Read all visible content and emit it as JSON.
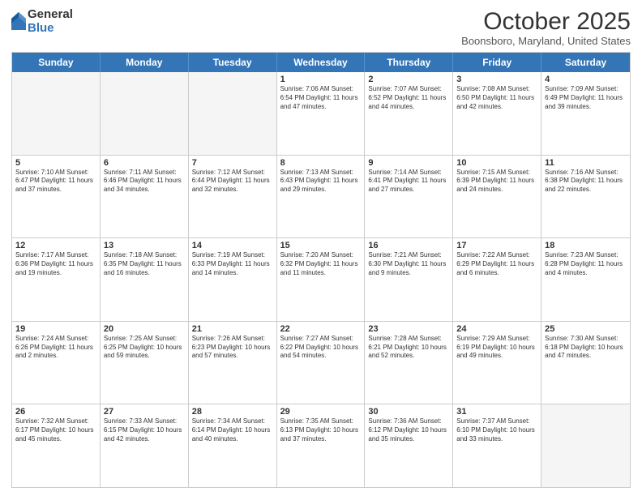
{
  "logo": {
    "general": "General",
    "blue": "Blue"
  },
  "title": {
    "month_year": "October 2025",
    "location": "Boonsboro, Maryland, United States"
  },
  "days_of_week": [
    "Sunday",
    "Monday",
    "Tuesday",
    "Wednesday",
    "Thursday",
    "Friday",
    "Saturday"
  ],
  "weeks": [
    [
      {
        "day": "",
        "text": "",
        "empty": true
      },
      {
        "day": "",
        "text": "",
        "empty": true
      },
      {
        "day": "",
        "text": "",
        "empty": true
      },
      {
        "day": "1",
        "text": "Sunrise: 7:06 AM\nSunset: 6:54 PM\nDaylight: 11 hours and 47 minutes."
      },
      {
        "day": "2",
        "text": "Sunrise: 7:07 AM\nSunset: 6:52 PM\nDaylight: 11 hours and 44 minutes."
      },
      {
        "day": "3",
        "text": "Sunrise: 7:08 AM\nSunset: 6:50 PM\nDaylight: 11 hours and 42 minutes."
      },
      {
        "day": "4",
        "text": "Sunrise: 7:09 AM\nSunset: 6:49 PM\nDaylight: 11 hours and 39 minutes."
      }
    ],
    [
      {
        "day": "5",
        "text": "Sunrise: 7:10 AM\nSunset: 6:47 PM\nDaylight: 11 hours and 37 minutes."
      },
      {
        "day": "6",
        "text": "Sunrise: 7:11 AM\nSunset: 6:46 PM\nDaylight: 11 hours and 34 minutes."
      },
      {
        "day": "7",
        "text": "Sunrise: 7:12 AM\nSunset: 6:44 PM\nDaylight: 11 hours and 32 minutes."
      },
      {
        "day": "8",
        "text": "Sunrise: 7:13 AM\nSunset: 6:43 PM\nDaylight: 11 hours and 29 minutes."
      },
      {
        "day": "9",
        "text": "Sunrise: 7:14 AM\nSunset: 6:41 PM\nDaylight: 11 hours and 27 minutes."
      },
      {
        "day": "10",
        "text": "Sunrise: 7:15 AM\nSunset: 6:39 PM\nDaylight: 11 hours and 24 minutes."
      },
      {
        "day": "11",
        "text": "Sunrise: 7:16 AM\nSunset: 6:38 PM\nDaylight: 11 hours and 22 minutes."
      }
    ],
    [
      {
        "day": "12",
        "text": "Sunrise: 7:17 AM\nSunset: 6:36 PM\nDaylight: 11 hours and 19 minutes."
      },
      {
        "day": "13",
        "text": "Sunrise: 7:18 AM\nSunset: 6:35 PM\nDaylight: 11 hours and 16 minutes."
      },
      {
        "day": "14",
        "text": "Sunrise: 7:19 AM\nSunset: 6:33 PM\nDaylight: 11 hours and 14 minutes."
      },
      {
        "day": "15",
        "text": "Sunrise: 7:20 AM\nSunset: 6:32 PM\nDaylight: 11 hours and 11 minutes."
      },
      {
        "day": "16",
        "text": "Sunrise: 7:21 AM\nSunset: 6:30 PM\nDaylight: 11 hours and 9 minutes."
      },
      {
        "day": "17",
        "text": "Sunrise: 7:22 AM\nSunset: 6:29 PM\nDaylight: 11 hours and 6 minutes."
      },
      {
        "day": "18",
        "text": "Sunrise: 7:23 AM\nSunset: 6:28 PM\nDaylight: 11 hours and 4 minutes."
      }
    ],
    [
      {
        "day": "19",
        "text": "Sunrise: 7:24 AM\nSunset: 6:26 PM\nDaylight: 11 hours and 2 minutes."
      },
      {
        "day": "20",
        "text": "Sunrise: 7:25 AM\nSunset: 6:25 PM\nDaylight: 10 hours and 59 minutes."
      },
      {
        "day": "21",
        "text": "Sunrise: 7:26 AM\nSunset: 6:23 PM\nDaylight: 10 hours and 57 minutes."
      },
      {
        "day": "22",
        "text": "Sunrise: 7:27 AM\nSunset: 6:22 PM\nDaylight: 10 hours and 54 minutes."
      },
      {
        "day": "23",
        "text": "Sunrise: 7:28 AM\nSunset: 6:21 PM\nDaylight: 10 hours and 52 minutes."
      },
      {
        "day": "24",
        "text": "Sunrise: 7:29 AM\nSunset: 6:19 PM\nDaylight: 10 hours and 49 minutes."
      },
      {
        "day": "25",
        "text": "Sunrise: 7:30 AM\nSunset: 6:18 PM\nDaylight: 10 hours and 47 minutes."
      }
    ],
    [
      {
        "day": "26",
        "text": "Sunrise: 7:32 AM\nSunset: 6:17 PM\nDaylight: 10 hours and 45 minutes."
      },
      {
        "day": "27",
        "text": "Sunrise: 7:33 AM\nSunset: 6:15 PM\nDaylight: 10 hours and 42 minutes."
      },
      {
        "day": "28",
        "text": "Sunrise: 7:34 AM\nSunset: 6:14 PM\nDaylight: 10 hours and 40 minutes."
      },
      {
        "day": "29",
        "text": "Sunrise: 7:35 AM\nSunset: 6:13 PM\nDaylight: 10 hours and 37 minutes."
      },
      {
        "day": "30",
        "text": "Sunrise: 7:36 AM\nSunset: 6:12 PM\nDaylight: 10 hours and 35 minutes."
      },
      {
        "day": "31",
        "text": "Sunrise: 7:37 AM\nSunset: 6:10 PM\nDaylight: 10 hours and 33 minutes."
      },
      {
        "day": "",
        "text": "",
        "empty": true
      }
    ]
  ]
}
